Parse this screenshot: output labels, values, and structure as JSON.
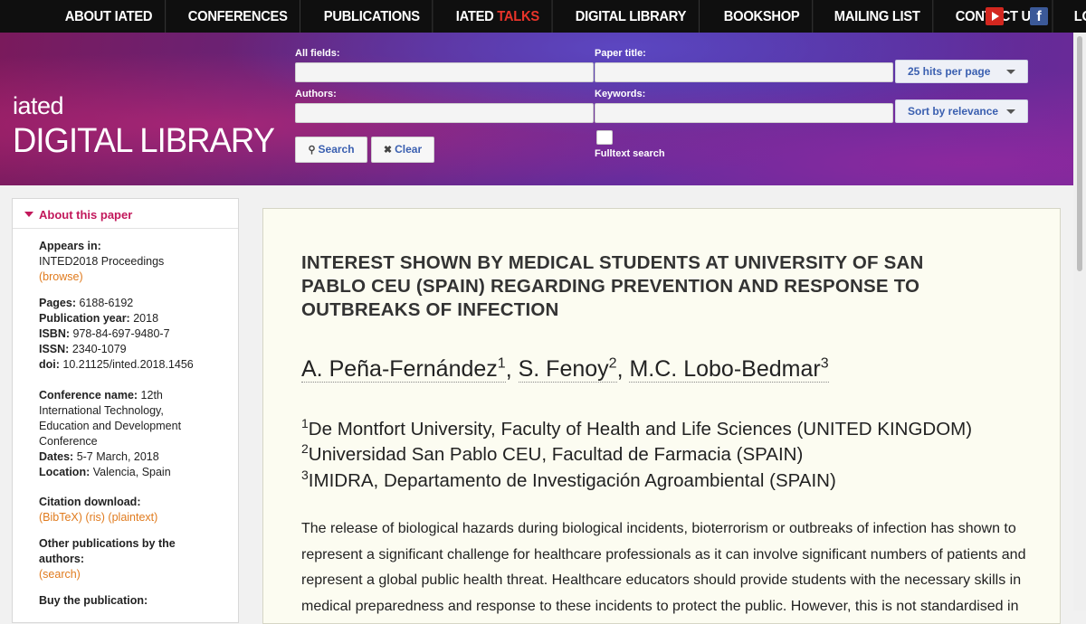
{
  "nav": {
    "items": [
      "ABOUT IATED",
      "CONFERENCES",
      "PUBLICATIONS",
      "IATED ",
      "DIGITAL LIBRARY",
      "BOOKSHOP",
      "MAILING LIST",
      "CONTACT US",
      "LOGIN"
    ],
    "talks_accent": "TALKS",
    "facebook_glyph": "f"
  },
  "brand": {
    "small": "iated",
    "big": "DIGITAL LIBRARY"
  },
  "search": {
    "all_fields_label": "All fields:",
    "paper_title_label": "Paper title:",
    "authors_label": "Authors:",
    "keywords_label": "Keywords:",
    "hits_per_page": "25 hits per page",
    "sort": "Sort by relevance",
    "search_button": "Search",
    "clear_button": "Clear",
    "fulltext_label": "Fulltext search"
  },
  "sidebar": {
    "header": "About this paper",
    "appears_in_label": "Appears in:",
    "appears_in_value": "INTED2018 Proceedings",
    "browse": "(browse)",
    "pages_label": "Pages:",
    "pages_value": " 6188-6192",
    "year_label": "Publication year:",
    "year_value": " 2018",
    "isbn_label": "ISBN:",
    "isbn_value": " 978-84-697-9480-7",
    "issn_label": "ISSN:",
    "issn_value": " 2340-1079",
    "doi_label": "doi:",
    "doi_value": " 10.21125/inted.2018.1456",
    "conf_label": "Conference name:",
    "conf_value_1": " 12th",
    "conf_value_2": "International Technology,",
    "conf_value_3": "Education and Development",
    "conf_value_4": "Conference",
    "dates_label": "Dates:",
    "dates_value": " 5-7 March, 2018",
    "location_label": "Location:",
    "location_value": " Valencia, Spain",
    "citation_label": "Citation download:",
    "bibtex": "(BibTeX)",
    "ris": "(ris)",
    "plaintext": "(plaintext)",
    "other_pubs_label_1": "Other publications by the",
    "other_pubs_label_2": "authors:",
    "search_link": "(search)",
    "buy_label": "Buy the publication:"
  },
  "paper": {
    "title_lines": [
      "INTEREST SHOWN BY MEDICAL STUDENTS AT UNIVERSITY OF SAN",
      "PABLO CEU (SPAIN) REGARDING PREVENTION AND RESPONSE TO",
      "OUTBREAKS OF INFECTION"
    ],
    "authors": [
      {
        "name": "A. Peña-Fernández",
        "sup": "1"
      },
      {
        "name": "S. Fenoy",
        "sup": "2"
      },
      {
        "name": "M.C. Lobo-Bedmar",
        "sup": "3"
      }
    ],
    "author_sep": ", ",
    "affiliations": [
      {
        "sup": "1",
        "text": "De Montfort University, Faculty of Health and Life Sciences (UNITED KINGDOM)"
      },
      {
        "sup": "2",
        "text": "Universidad San Pablo CEU, Facultad de Farmacia (SPAIN)"
      },
      {
        "sup": "3",
        "text": "IMIDRA, Departamento de Investigación Agroambiental (SPAIN)"
      }
    ],
    "abstract_lines": [
      "The release of biological hazards during biological incidents, bioterrorism or outbreaks of infection has shown to",
      "represent a significant challenge for healthcare professionals as it can involve significant numbers of patients and",
      "represent a global public health threat. Healthcare educators should provide students with the necessary skills in",
      "medical preparedness and response to these incidents to protect the public. However, this is not standardised in"
    ]
  }
}
